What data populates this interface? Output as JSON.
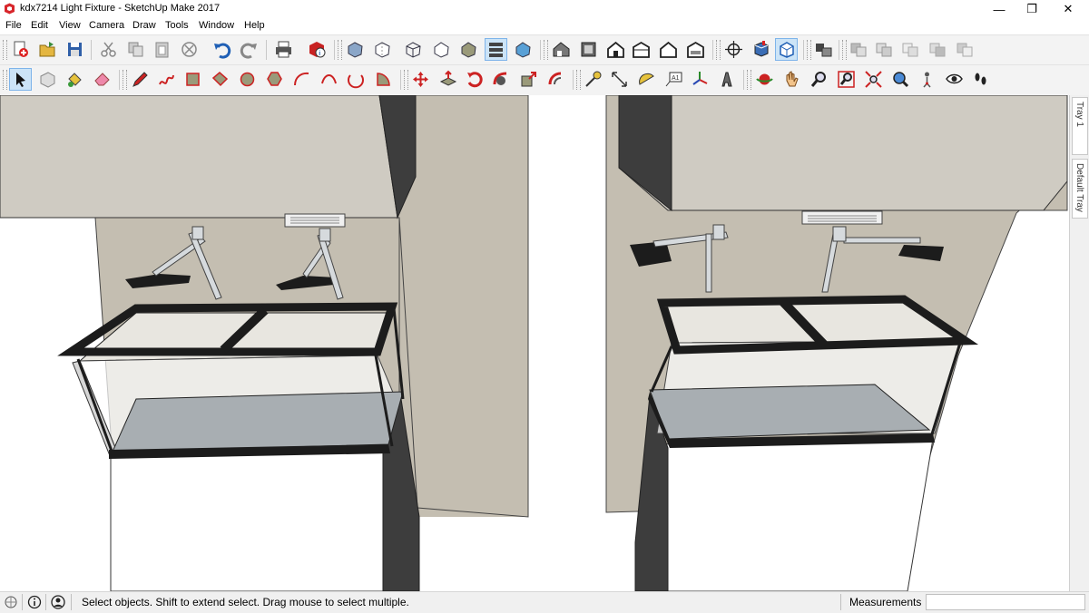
{
  "window": {
    "title": "kdx7214 Light Fixture - SketchUp Make 2017",
    "minimize_glyph": "—",
    "restore_glyph": "❐",
    "close_glyph": "✕"
  },
  "menu": {
    "items": [
      "File",
      "Edit",
      "View",
      "Camera",
      "Draw",
      "Tools",
      "Window",
      "Help"
    ]
  },
  "toolbar_top": {
    "groups": [
      [
        "new-file-icon",
        "open-folder-icon",
        "save-disk-icon"
      ],
      [
        "cut-scissors-icon",
        "copy-icon",
        "paste-icon",
        "erase-circle-icon",
        "undo-icon",
        "redo-icon"
      ],
      [
        "print-icon",
        "model-info-icon"
      ],
      [
        "xray-style-icon",
        "back-edges-style-icon",
        "wireframe-style-icon",
        "hidden-line-style-icon",
        "shaded-style-icon",
        "shaded-textures-style-icon",
        "monochrome-style-icon"
      ],
      [
        "iso-view-icon",
        "top-view-icon",
        "front-view-icon",
        "right-view-icon",
        "back-view-icon",
        "left-view-icon"
      ],
      [
        "section-plane-icon",
        "display-section-planes-icon",
        "display-section-cuts-icon"
      ],
      [
        "components-icon"
      ],
      [
        "outer-shell-icon",
        "intersect-icon",
        "union-icon",
        "subtract-icon",
        "trim-icon"
      ]
    ],
    "active": [
      "shaded-style-icon",
      "display-section-cuts-icon"
    ]
  },
  "toolbar_bottom": {
    "groups": [
      [
        "select-arrow-icon",
        "make-component-icon",
        "paint-bucket-icon",
        "eraser-icon"
      ],
      [
        "pencil-line-icon",
        "freehand-icon",
        "rectangle-icon",
        "rotated-rectangle-icon",
        "circle-icon",
        "polygon-icon",
        "arc-icon",
        "two-point-arc-icon",
        "three-point-arc-icon",
        "pie-icon"
      ],
      [
        "move-icon",
        "push-pull-icon",
        "rotate-icon",
        "follow-me-icon",
        "scale-icon",
        "offset-icon"
      ],
      [
        "tape-measure-icon",
        "dimension-icon",
        "protractor-icon",
        "text-label-icon",
        "axes-icon",
        "3d-text-icon"
      ],
      [
        "orbit-icon",
        "pan-hand-icon",
        "zoom-magnifier-icon",
        "zoom-window-icon",
        "zoom-extents-icon",
        "previous-view-icon",
        "position-camera-icon",
        "look-around-eye-icon",
        "walk-footprints-icon"
      ]
    ],
    "active": [
      "select-arrow-icon"
    ]
  },
  "tray": {
    "tabs": [
      "Tray 1",
      "Default Tray"
    ]
  },
  "status": {
    "text": "Select objects. Shift to extend select. Drag mouse to select multiple.",
    "measurements_label": "Measurements",
    "measurements_value": ""
  },
  "colors": {
    "wall": "#c4beb1",
    "shelf_front": "#cfcbc2",
    "shelf_side": "#3d3d3d",
    "tank_frame": "#1c1c1c",
    "tank_floor": "#a8aeb2",
    "fixture_arm": "#d6dadd",
    "toolbar_bg": "#f3f3f3",
    "accent": "#cc2222"
  }
}
